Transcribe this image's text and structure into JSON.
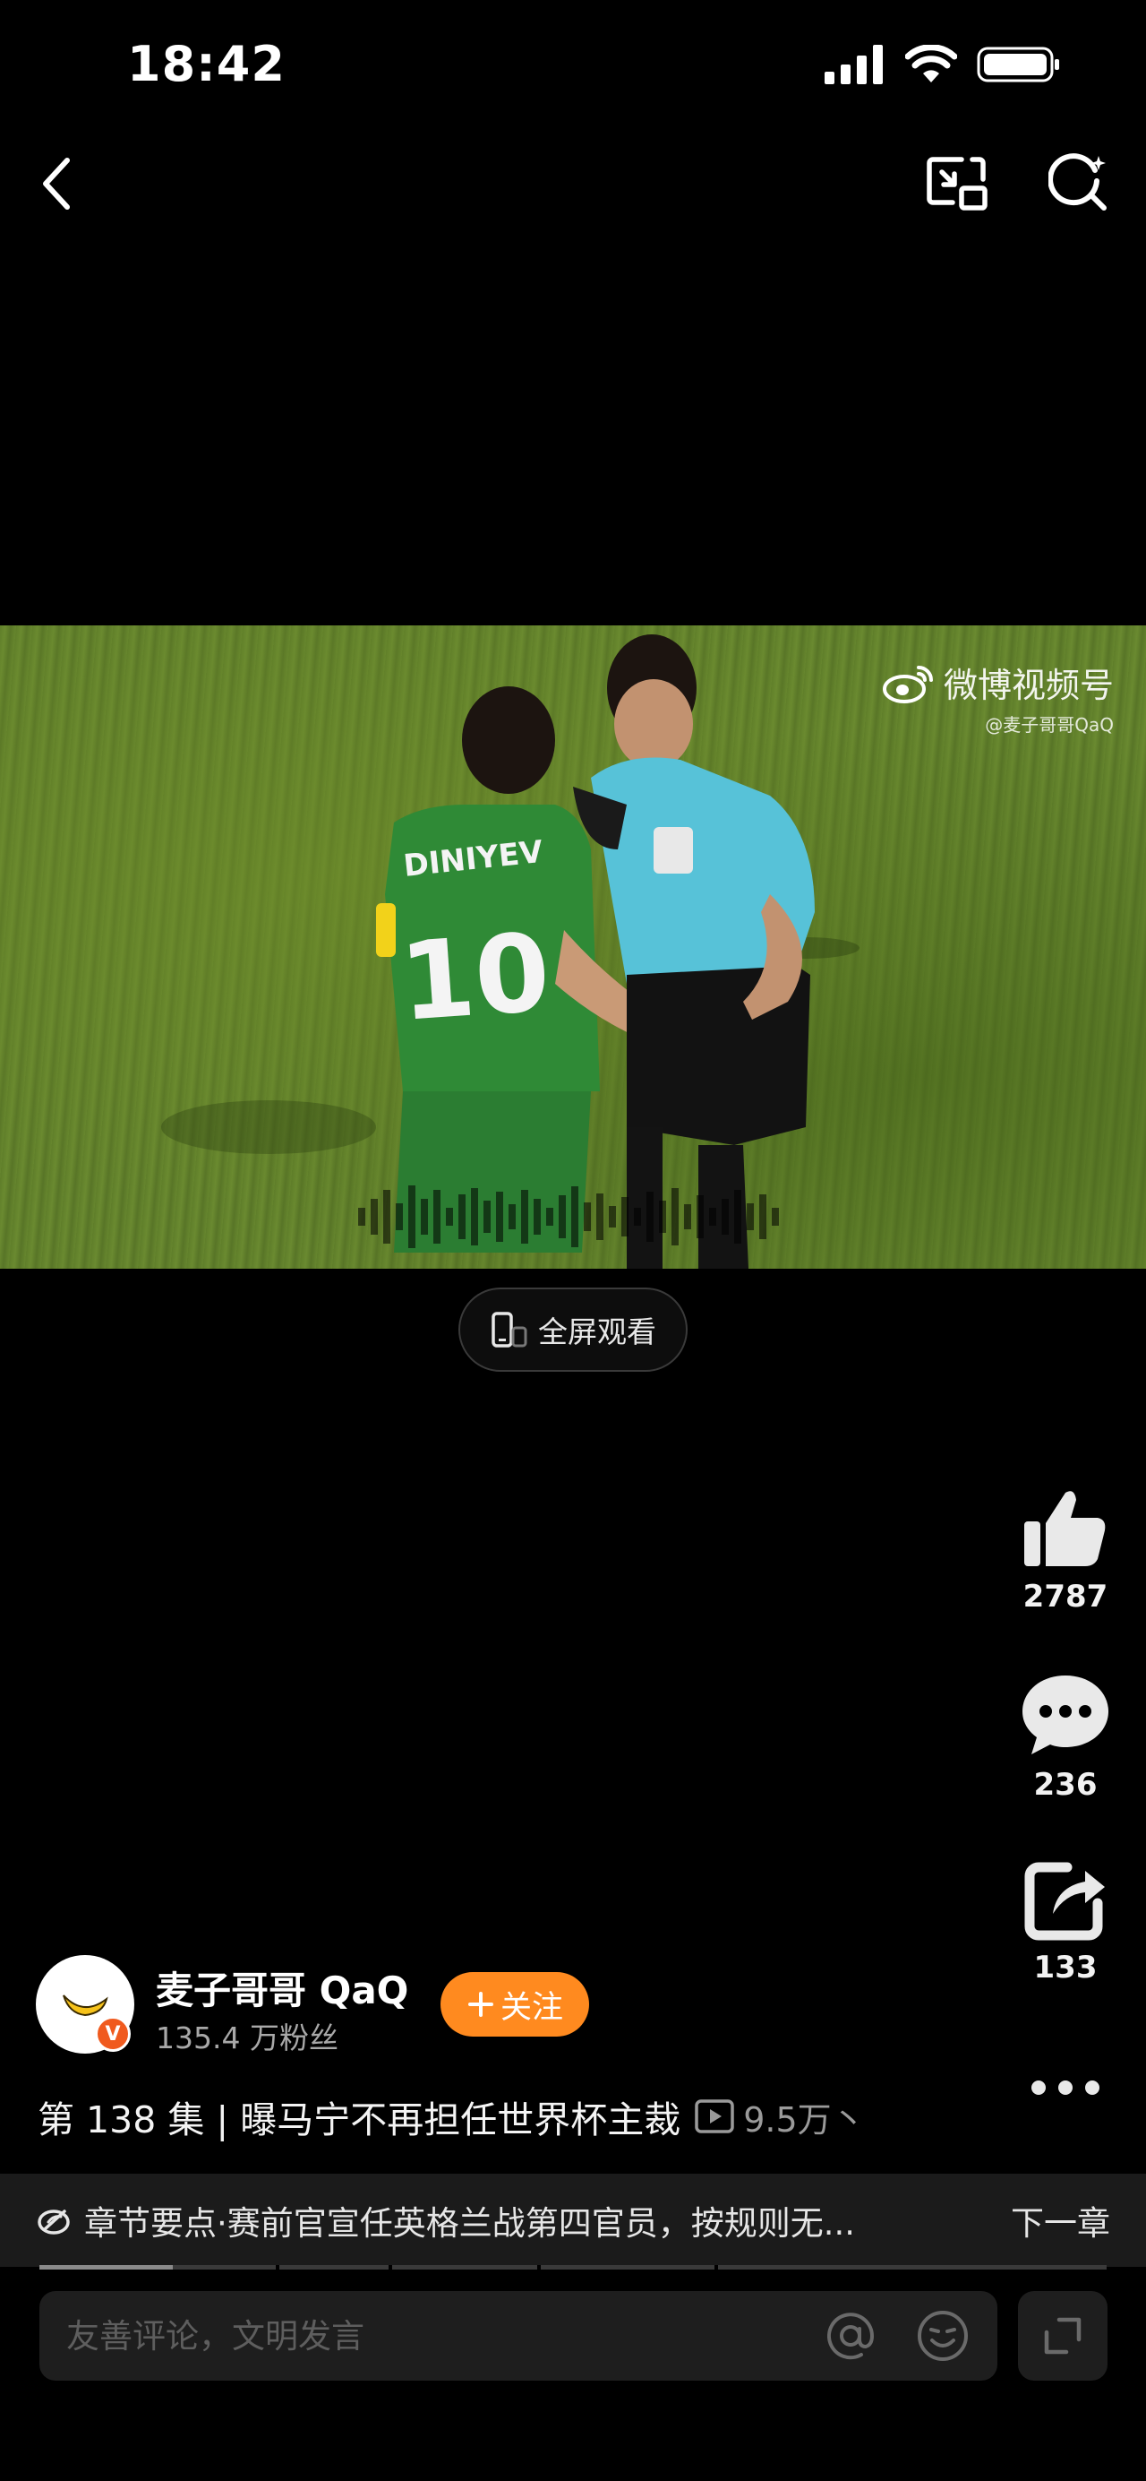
{
  "status_bar": {
    "time": "18:42"
  },
  "video": {
    "watermark_brand": "微博视频号",
    "watermark_handle": "@麦子哥哥QaQ",
    "fullscreen_label": "全屏观看"
  },
  "actions": {
    "likes": "2787",
    "comments": "236",
    "shares": "133"
  },
  "author": {
    "name": "麦子哥哥 QaQ",
    "fans": "135.4 万粉丝",
    "follow_label": "关注",
    "verified_mark": "V"
  },
  "post": {
    "title": "第 138 集 | 曝马宁不再担任世界杯主裁",
    "views": "9.5万丶"
  },
  "chapter": {
    "text": "章节要点·赛前官宣任英格兰战第四官员，按规则无...",
    "next_label": "下一章",
    "progress": 0.125
  },
  "comment_input": {
    "placeholder": "友善评论，文明发言"
  },
  "colors": {
    "accent": "#ff8a1f",
    "verified": "#f05a1e",
    "background": "#000000"
  },
  "icons": [
    "back-icon",
    "pip-icon",
    "search-icon",
    "weibo-icon",
    "phone-icon",
    "like-icon",
    "comment-icon",
    "share-icon",
    "more-icon",
    "at-icon",
    "emoji-icon",
    "expand-icon",
    "chapter-icon",
    "play-icon"
  ]
}
